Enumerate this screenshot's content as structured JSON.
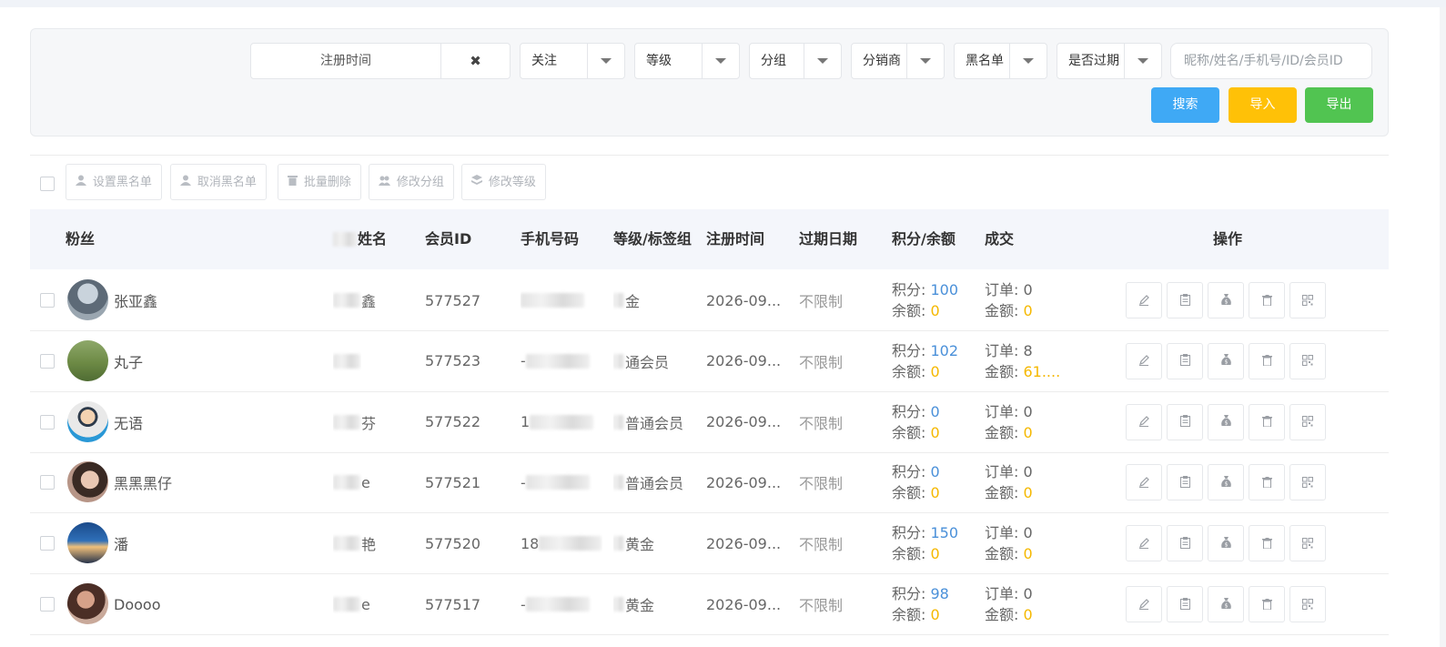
{
  "filters": {
    "date_label": "注册时间",
    "clear_symbol": "✖",
    "selects": [
      "关注",
      "等级",
      "分组",
      "分销商",
      "黑名单",
      "是否过期"
    ],
    "search_placeholder": "昵称/姓名/手机号/ID/会员ID",
    "buttons": {
      "search": "搜索",
      "import": "导入",
      "export": "导出"
    }
  },
  "colors": {
    "search_btn": "#3fa9f5",
    "import_btn": "#ffc107",
    "export_btn": "#51c451",
    "points_value": "#4a90d9",
    "money_value": "#f5b800"
  },
  "actions": [
    "设置黑名单",
    "取消黑名单",
    "批量删除",
    "修改分组",
    "修改等级"
  ],
  "action_icons": [
    "user-icon",
    "user-icon",
    "trash-icon",
    "users-icon",
    "layers-icon"
  ],
  "columns": {
    "fan": "粉丝",
    "name": "姓名",
    "member_id": "会员ID",
    "phone": "手机号码",
    "level": "等级/标签组",
    "reg_time": "注册时间",
    "expire": "过期日期",
    "points": "积分/余额",
    "deal": "成交",
    "ops": "操作"
  },
  "labels": {
    "points": "积分: ",
    "balance": "余额: ",
    "orders": "订单: ",
    "amount": "金额: "
  },
  "op_icons": [
    "edit-icon",
    "clipboard-icon",
    "money-bag-icon",
    "trash-icon",
    "qrcode-icon"
  ],
  "rows": [
    {
      "nick": "张亚鑫",
      "name": "鑫",
      "member_id": "577527",
      "phone": "",
      "level": "金",
      "reg": "2026-09...",
      "expire": "不限制",
      "points": "100",
      "balance": "0",
      "orders": "0",
      "amount": "0"
    },
    {
      "nick": "丸子",
      "name": "",
      "member_id": "577523",
      "phone": "-",
      "level": "通会员",
      "reg": "2026-09...",
      "expire": "不限制",
      "points": "102",
      "balance": "0",
      "orders": "8",
      "amount": "61...."
    },
    {
      "nick": "无语",
      "name": "芬",
      "member_id": "577522",
      "phone": "1",
      "level": "普通会员",
      "reg": "2026-09...",
      "expire": "不限制",
      "points": "0",
      "balance": "0",
      "orders": "0",
      "amount": "0"
    },
    {
      "nick": "黑黑黑仔",
      "name": "e",
      "member_id": "577521",
      "phone": "-",
      "level": "普通会员",
      "reg": "2026-09...",
      "expire": "不限制",
      "points": "0",
      "balance": "0",
      "orders": "0",
      "amount": "0"
    },
    {
      "nick": "潘",
      "name": "艳",
      "member_id": "577520",
      "phone": "18",
      "level": "黄金",
      "reg": "2026-09...",
      "expire": "不限制",
      "points": "150",
      "balance": "0",
      "orders": "0",
      "amount": "0"
    },
    {
      "nick": "Doooo",
      "name": "e",
      "member_id": "577517",
      "phone": "-",
      "level": "黄金",
      "reg": "2026-09...",
      "expire": "不限制",
      "points": "98",
      "balance": "0",
      "orders": "0",
      "amount": "0"
    }
  ]
}
